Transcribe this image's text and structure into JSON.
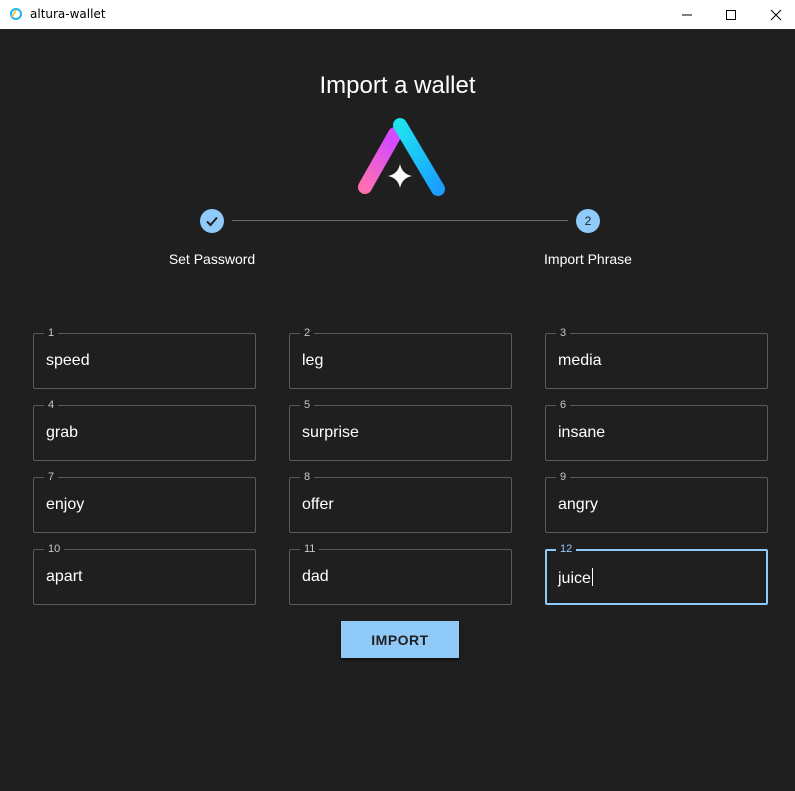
{
  "window": {
    "title": "altura-wallet"
  },
  "page": {
    "title": "Import a wallet"
  },
  "stepper": {
    "steps": [
      {
        "label": "Set Password",
        "status": "completed",
        "icon": "check-icon"
      },
      {
        "label": "Import Phrase",
        "status": "active",
        "number": "2"
      }
    ]
  },
  "phrase": {
    "words": [
      {
        "index": "1",
        "value": "speed"
      },
      {
        "index": "2",
        "value": "leg"
      },
      {
        "index": "3",
        "value": "media"
      },
      {
        "index": "4",
        "value": "grab"
      },
      {
        "index": "5",
        "value": "surprise"
      },
      {
        "index": "6",
        "value": "insane"
      },
      {
        "index": "7",
        "value": "enjoy"
      },
      {
        "index": "8",
        "value": "offer"
      },
      {
        "index": "9",
        "value": "angry"
      },
      {
        "index": "10",
        "value": "apart"
      },
      {
        "index": "11",
        "value": "dad"
      },
      {
        "index": "12",
        "value": "juice"
      }
    ],
    "focused_index": "12"
  },
  "actions": {
    "import_label": "IMPORT"
  },
  "colors": {
    "accent": "#90caf9",
    "background": "#1f1f1f",
    "border": "#5a5a5a"
  }
}
